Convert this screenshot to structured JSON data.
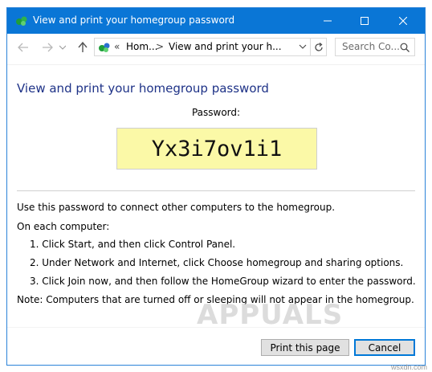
{
  "window": {
    "title": "View and print your homegroup password"
  },
  "navbar": {
    "address": {
      "crumb1": "Hom...",
      "separator": ">",
      "crumb2": "View and print your h...",
      "overflow_chevron": "«"
    },
    "search": {
      "placeholder": "Search Co..."
    }
  },
  "content": {
    "heading": "View and print your homegroup password",
    "password_label": "Password:",
    "password_value": "Yx3i7ov1i1",
    "intro": "Use this password to connect other computers to the homegroup.",
    "each_computer": "On each computer:",
    "steps": [
      "1. Click Start, and then click Control Panel.",
      "2. Under Network and Internet, click Choose homegroup and sharing options.",
      "3. Click Join now, and then follow the HomeGroup wizard to enter the password."
    ],
    "note": "Note: Computers that are turned off or sleeping will not appear in the homegroup."
  },
  "footer": {
    "print_label": "Print this page",
    "cancel_label": "Cancel"
  },
  "watermark": {
    "logo_text": "APPUALS",
    "site": "wsxdn.com"
  },
  "icons": {
    "app": "homegroup-icon",
    "minimize": "minimize-icon",
    "maximize": "maximize-icon",
    "close": "close-icon",
    "back": "back-arrow-icon",
    "forward": "forward-arrow-icon",
    "recent": "chevron-down-icon",
    "up": "up-arrow-icon",
    "refresh": "refresh-icon",
    "search": "search-icon"
  },
  "colors": {
    "titlebar": "#0a76d6",
    "heading": "#1e3287",
    "password_bg": "#fbf9a7"
  }
}
